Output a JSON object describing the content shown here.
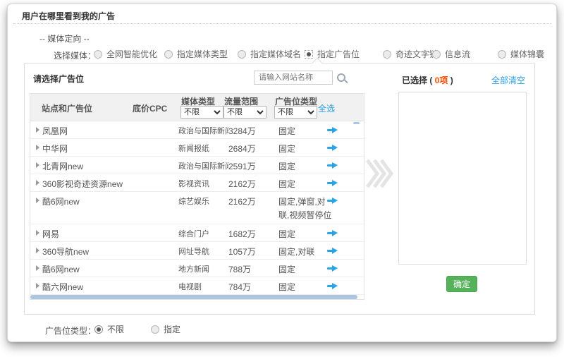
{
  "page": {
    "title": "用户在哪里看到我的广告",
    "section_label": "-- 媒体定向 --"
  },
  "media_select": {
    "label": "选择媒体：",
    "options": [
      {
        "label": "全网智能优化",
        "selected": false
      },
      {
        "label": "指定媒体类型",
        "selected": false
      },
      {
        "label": "指定媒体域名",
        "selected": false
      },
      {
        "label": "指定广告位",
        "selected": true
      },
      {
        "label": "奇迹文字链",
        "selected": false
      },
      {
        "label": "信息流",
        "selected": false
      },
      {
        "label": "媒体锦囊",
        "selected": false
      }
    ]
  },
  "placement_panel": {
    "title": "请选择广告位",
    "search": {
      "placeholder": "请输入网站名称",
      "icon": "search-icon"
    },
    "table": {
      "columns": [
        "站点和广告位",
        "底价CPC",
        "媒体类型",
        "流量范围",
        "广告位类型"
      ],
      "filters": [
        {
          "column": "媒体类型",
          "value": "不限"
        },
        {
          "column": "流量范围",
          "value": "不限"
        },
        {
          "column": "广告位类型",
          "value": "不限"
        }
      ],
      "select_all_label": "全选",
      "rows": [
        {
          "site": "凤凰网",
          "cpc": "",
          "media_type": "政治与国际新闻",
          "traffic": "3284万",
          "slot_type": "固定"
        },
        {
          "site": "中华网",
          "cpc": "",
          "media_type": "新闻报纸",
          "traffic": "2684万",
          "slot_type": "固定"
        },
        {
          "site": "北青网new",
          "cpc": "",
          "media_type": "政治与国际新闻",
          "traffic": "2591万",
          "slot_type": "固定"
        },
        {
          "site": "360影视奇迹资源new",
          "cpc": "",
          "media_type": "影视资讯",
          "traffic": "2162万",
          "slot_type": "固定"
        },
        {
          "site": "酷6网new",
          "cpc": "",
          "media_type": "综艺娱乐",
          "traffic": "2162万",
          "slot_type": "固定,弹窗,对联,视频暂停位"
        },
        {
          "site": "网易",
          "cpc": "",
          "media_type": "综合门户",
          "traffic": "1682万",
          "slot_type": "固定"
        },
        {
          "site": "360导航new",
          "cpc": "",
          "media_type": "网址导航",
          "traffic": "1057万",
          "slot_type": "固定,对联"
        },
        {
          "site": "酷6网new",
          "cpc": "",
          "media_type": "地方新闻",
          "traffic": "788万",
          "slot_type": "固定"
        },
        {
          "site": "酷六网new",
          "cpc": "",
          "media_type": "电视剧",
          "traffic": "784万",
          "slot_type": "固定"
        }
      ]
    }
  },
  "selected_panel": {
    "title_prefix": "已选择 ( ",
    "count": "0项",
    "title_suffix": " )",
    "clear_all_label": "全部清空",
    "confirm_label": "确定"
  },
  "slot_type_select": {
    "label": "广告位类型：",
    "options": [
      {
        "label": "不限",
        "selected": true
      },
      {
        "label": "指定",
        "selected": false
      }
    ]
  },
  "colors": {
    "link_blue": "#2b9fe6",
    "arrow_blue": "#2aa3e9",
    "count_red": "#ff4a00",
    "confirm_green": "#55b25a",
    "scrollbar_blue": "#adc6e0",
    "header_gray": "#f1f1f1"
  }
}
